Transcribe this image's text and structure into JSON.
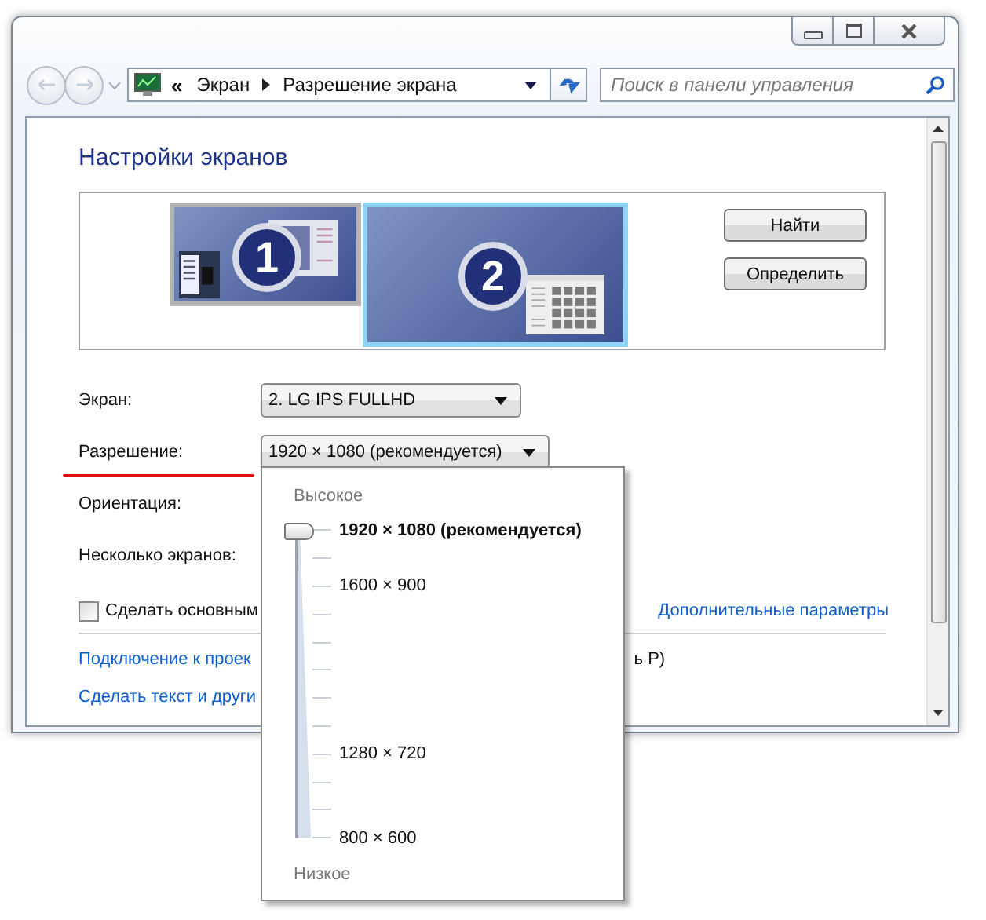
{
  "address_bar": {
    "overflow": "«",
    "crumbs": [
      {
        "label": "Экран"
      },
      {
        "label": "Разрешение экрана"
      }
    ]
  },
  "search": {
    "placeholder": "Поиск в панели управления"
  },
  "title": "Настройки экранов",
  "monitors": [
    {
      "number": "1",
      "selected": false
    },
    {
      "number": "2",
      "selected": true
    }
  ],
  "monitor_buttons": [
    "Найти",
    "Определить"
  ],
  "settings": [
    {
      "label": "Экран:",
      "kind": "dropdown",
      "value": "2. LG IPS FULLHD"
    },
    {
      "label": "Разрешение:",
      "kind": "dropdown",
      "value": "1920 × 1080 (рекомендуется)",
      "underlined": true
    },
    {
      "label": "Ориентация:",
      "kind": "label"
    },
    {
      "label": "Несколько экранов:",
      "kind": "label"
    }
  ],
  "primary_checkbox": {
    "label": "Сделать основным",
    "checked": false
  },
  "advanced_link": "Дополнительные параметры",
  "links": [
    {
      "text": "Подключение к проек",
      "trailing": "ь P)"
    },
    {
      "text": "Сделать текст и други"
    }
  ],
  "resolution_popup": {
    "high_label": "Высокое",
    "low_label": "Низкое",
    "level": 1,
    "ticks": [
      {
        "kind": "option",
        "label": "1920 × 1080 (рекомендуется)",
        "selected": true
      },
      {
        "kind": "tick"
      },
      {
        "kind": "option",
        "label": "1600 × 900",
        "selected": false
      },
      {
        "kind": "tick"
      },
      {
        "kind": "tick"
      },
      {
        "kind": "tick"
      },
      {
        "kind": "tick"
      },
      {
        "kind": "tick"
      },
      {
        "kind": "option",
        "label": "1280 × 720",
        "selected": false
      },
      {
        "kind": "tick"
      },
      {
        "kind": "tick"
      },
      {
        "kind": "option",
        "label": "800 × 600",
        "selected": false
      }
    ]
  }
}
